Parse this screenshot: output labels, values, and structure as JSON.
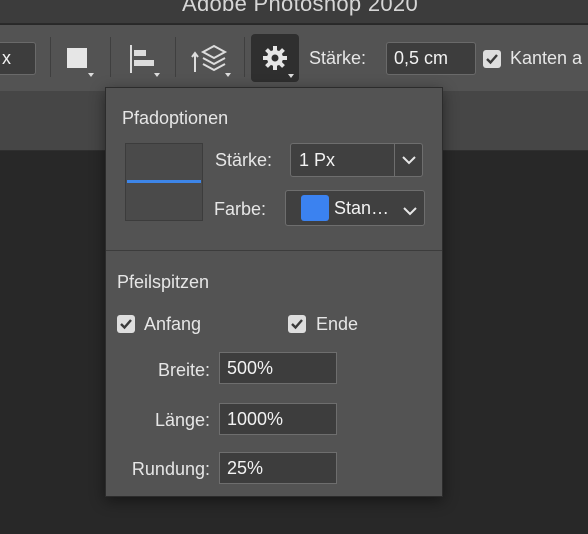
{
  "window": {
    "title": "Adobe Photoshop 2020"
  },
  "optionsbar": {
    "left_field_value": "x",
    "strength_label": "Stärke:",
    "strength_value": "0,5 cm",
    "edges_label": "Kanten a",
    "edges_checked": true
  },
  "popup": {
    "path_options_title": "Pfadoptionen",
    "stroke_label": "Stärke:",
    "stroke_value": "1 Px",
    "color_label": "Farbe:",
    "color_value": "Stan…",
    "color_swatch": "#3b82f0",
    "preview_line_color": "#3d85e8",
    "arrowheads_title": "Pfeilspitzen",
    "start_label": "Anfang",
    "start_checked": true,
    "end_label": "Ende",
    "end_checked": true,
    "width_label": "Breite:",
    "width_value": "500%",
    "length_label": "Länge:",
    "length_value": "1000%",
    "curvature_label": "Rundung:",
    "curvature_value": "25%"
  },
  "icons": {
    "fill": "square-fill-icon",
    "align": "align-left-edges-icon",
    "arrange": "arrange-layers-icon",
    "settings": "gear-icon",
    "dropdown": "chevron-down-icon",
    "checkbox": "checkmark-icon"
  }
}
